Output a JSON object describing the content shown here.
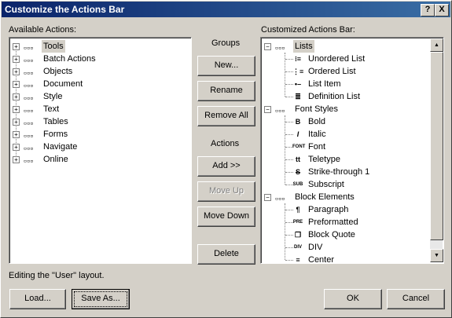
{
  "window": {
    "title": "Customize the Actions Bar",
    "help_label": "?",
    "close_label": "X"
  },
  "available": {
    "label": "Available Actions:",
    "items": [
      "Tools",
      "Batch Actions",
      "Objects",
      "Document",
      "Style",
      "Text",
      "Tables",
      "Forms",
      "Navigate",
      "Online"
    ]
  },
  "groups": {
    "label": "Groups",
    "new": "New...",
    "rename": "Rename",
    "remove_all": "Remove All"
  },
  "actions": {
    "label": "Actions",
    "add": "Add  >>",
    "move_up": "Move Up",
    "move_down": "Move Down",
    "delete": "Delete"
  },
  "customized": {
    "label": "Customized Actions Bar:",
    "groups": [
      {
        "name": "Lists",
        "items": [
          {
            "label": "Unordered List",
            "icon": "unordered-list-icon"
          },
          {
            "label": "Ordered List",
            "icon": "ordered-list-icon"
          },
          {
            "label": "List Item",
            "icon": "list-item-icon"
          },
          {
            "label": "Definition List",
            "icon": "definition-list-icon"
          }
        ]
      },
      {
        "name": "Font Styles",
        "items": [
          {
            "label": "Bold",
            "icon": "bold-icon"
          },
          {
            "label": "Italic",
            "icon": "italic-icon"
          },
          {
            "label": "Font",
            "icon": "font-icon"
          },
          {
            "label": "Teletype",
            "icon": "teletype-icon"
          },
          {
            "label": "Strike-through 1",
            "icon": "strikethrough-icon"
          },
          {
            "label": "Subscript",
            "icon": "subscript-icon"
          }
        ]
      },
      {
        "name": "Block Elements",
        "items": [
          {
            "label": "Paragraph",
            "icon": "paragraph-icon"
          },
          {
            "label": "Preformatted",
            "icon": "preformatted-icon"
          },
          {
            "label": "Block Quote",
            "icon": "block-quote-icon"
          },
          {
            "label": "DIV",
            "icon": "div-icon"
          },
          {
            "label": "Center",
            "icon": "center-icon"
          }
        ]
      }
    ]
  },
  "status": "Editing the \"User\" layout.",
  "footer": {
    "load": "Load...",
    "save_as": "Save As...",
    "ok": "OK",
    "cancel": "Cancel"
  },
  "icons": {
    "group": "▫▫▫",
    "expand": "+",
    "collapse": "−",
    "glyph_unordered": "⁝≡",
    "glyph_ordered": "⋮≡",
    "glyph_listitem": "•–",
    "glyph_deflist": "≣",
    "glyph_bold": "B",
    "glyph_italic": "I",
    "glyph_font": "FONT",
    "glyph_teletype": "tt",
    "glyph_strike": "S",
    "glyph_sub": "SUB",
    "glyph_para": "¶",
    "glyph_pre": "PRE",
    "glyph_quote": "❐",
    "glyph_div": "DIV",
    "glyph_center": "≡",
    "scroll_up": "▲",
    "scroll_down": "▼"
  }
}
